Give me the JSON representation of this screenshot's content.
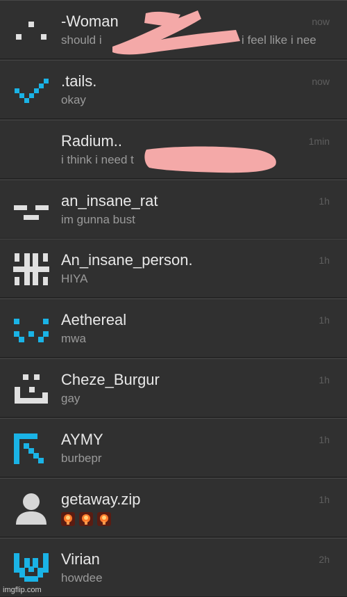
{
  "chats": [
    {
      "name": "-Woman",
      "message": "should i",
      "message_tail": "i feel like i nee",
      "time": "now",
      "avatar_icon": "dots-face-icon",
      "accent": "#e0e0e0"
    },
    {
      "name": ".tails.",
      "message": "okay",
      "time": "now",
      "avatar_icon": "checkmark-icon",
      "accent": "#1ab3e6"
    },
    {
      "name": "Radium..",
      "message": "i think i need t",
      "time": "1min",
      "avatar_icon": "none"
    },
    {
      "name": "an_insane_rat",
      "message": "im gunna bust",
      "time": "1h",
      "avatar_icon": "bar-face-icon",
      "accent": "#e0e0e0"
    },
    {
      "name": "An_insane_person.",
      "message": "HIYA",
      "time": "1h",
      "avatar_icon": "hash-glyph-icon",
      "accent": "#e0e0e0"
    },
    {
      "name": "Aethereal",
      "message": "mwa",
      "time": "1h",
      "avatar_icon": "w-face-icon",
      "accent": "#1ab3e6"
    },
    {
      "name": "Cheze_Burgur",
      "message": "gay",
      "time": "1h",
      "avatar_icon": "pixel-face-icon",
      "accent": "#e0e0e0"
    },
    {
      "name": "AYMY",
      "message": "burbepr",
      "time": "1h",
      "avatar_icon": "arrow-glyph-icon",
      "accent": "#1ab3e6"
    },
    {
      "name": "getaway.zip",
      "message": "",
      "message_emojis": [
        "explosion-emoji-icon",
        "explosion-emoji-icon",
        "explosion-emoji-icon"
      ],
      "time": "1h",
      "avatar_icon": "default-user-icon",
      "accent": "#e0e0e0"
    },
    {
      "name": "Virian",
      "message": "howdee",
      "time": "2h",
      "avatar_icon": "shield-glyph-icon",
      "accent": "#1ab3e6"
    }
  ],
  "colors": {
    "background": "#303030",
    "name": "#e8e8e8",
    "message": "#9a9a9a",
    "time": "#5e5e5e",
    "accent_blue": "#1ab3e6",
    "censor_pink": "#f4a9a8"
  },
  "watermark": "imgflip.com"
}
